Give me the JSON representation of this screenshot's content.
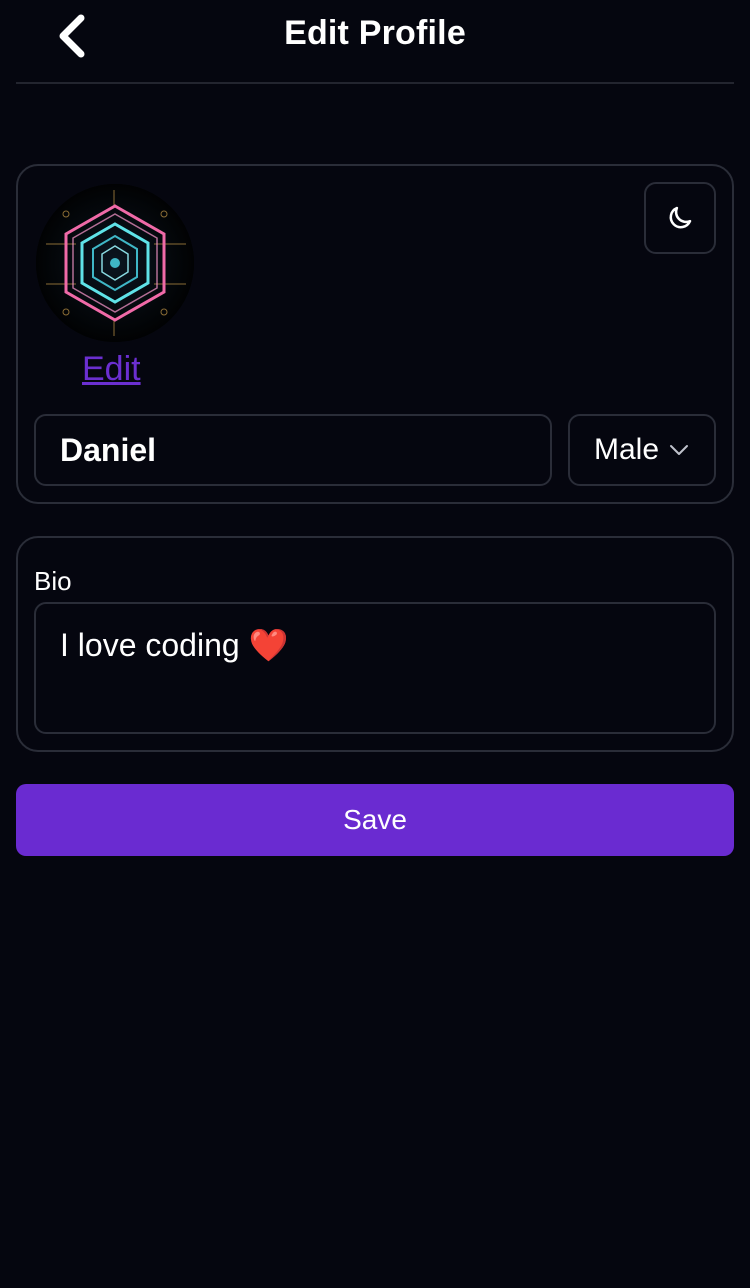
{
  "header": {
    "title": "Edit Profile"
  },
  "profile": {
    "edit_label": "Edit",
    "name_value": "Daniel",
    "gender_selected": "Male"
  },
  "bio": {
    "label": "Bio",
    "value": "I love coding ❤️"
  },
  "actions": {
    "save_label": "Save"
  },
  "colors": {
    "background": "#05060f",
    "accent": "#6a2bd1",
    "border": "#2a2d38",
    "link": "#6b2fd0"
  },
  "icons": {
    "back": "chevron-left-icon",
    "theme": "moon-icon",
    "dropdown": "chevron-down-icon"
  }
}
